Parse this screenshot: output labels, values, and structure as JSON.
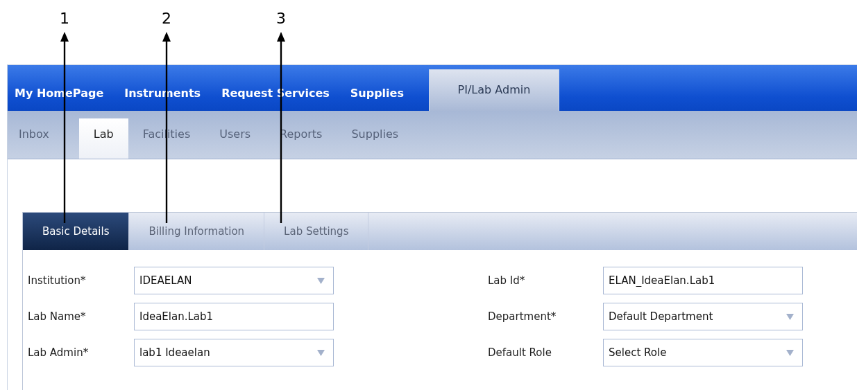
{
  "callouts": [
    {
      "label": "1"
    },
    {
      "label": "2"
    },
    {
      "label": "3"
    }
  ],
  "main_nav": [
    {
      "label": "My HomePage",
      "selected": false
    },
    {
      "label": "Instruments",
      "selected": false
    },
    {
      "label": "Request Services",
      "selected": false
    },
    {
      "label": "Supplies",
      "selected": false
    },
    {
      "label": "PI/Lab Admin",
      "selected": true
    }
  ],
  "sub_nav": [
    {
      "label": "Inbox",
      "selected": false
    },
    {
      "label": "Lab",
      "selected": true
    },
    {
      "label": "Facilities",
      "selected": false
    },
    {
      "label": "Users",
      "selected": false
    },
    {
      "label": "Reports",
      "selected": false
    },
    {
      "label": "Supplies",
      "selected": false
    }
  ],
  "tabs": [
    {
      "label": "Basic Details",
      "selected": true
    },
    {
      "label": "Billing Information",
      "selected": false
    },
    {
      "label": "Lab Settings",
      "selected": false
    }
  ],
  "form": {
    "left": [
      {
        "label": "Institution*",
        "kind": "select",
        "value": "IDEAELAN"
      },
      {
        "label": "Lab Name*",
        "kind": "text",
        "value": "IdeaElan.Lab1"
      },
      {
        "label": "Lab Admin*",
        "kind": "select",
        "value": "lab1 Ideaelan"
      }
    ],
    "right": [
      {
        "label": "Lab Id*",
        "kind": "text",
        "value": "ELAN_IdeaElan.Lab1"
      },
      {
        "label": "Department*",
        "kind": "select",
        "value": "Default Department"
      },
      {
        "label": "Default Role",
        "kind": "select",
        "value": "Select Role"
      }
    ]
  }
}
